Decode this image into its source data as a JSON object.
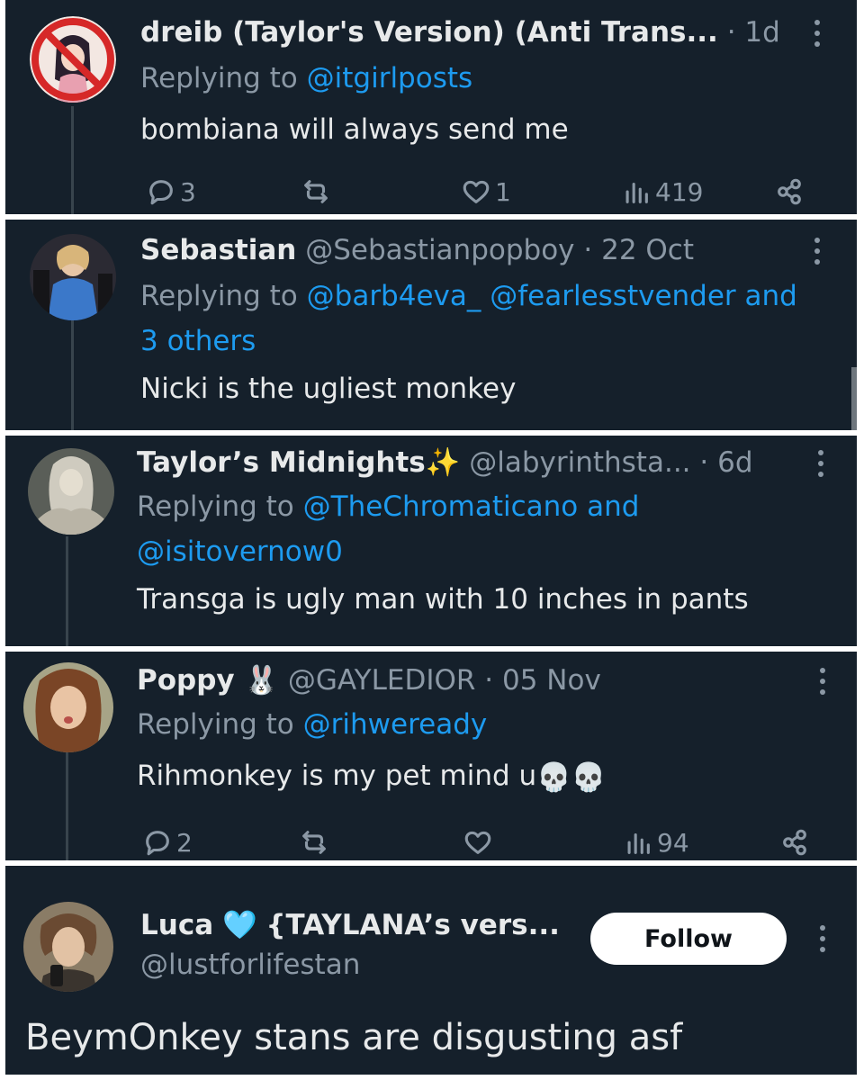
{
  "tweets": [
    {
      "name": "dreib (Taylor's Version) (Anti Trans...",
      "time": "· 1d",
      "replying_prefix": "Replying to",
      "replying_to": "@itgirlposts",
      "text": "bombiana will always send me",
      "actions": {
        "replies": "3",
        "likes": "1",
        "views": "419"
      }
    },
    {
      "name": "Sebastian",
      "handle": "@Sebastianpopboy",
      "time": "· 22 Oct",
      "replying_prefix": "Replying to",
      "replying_to_line1": "@barb4eva_ @fearlesstvender and",
      "replying_to_line2": "3 others",
      "text": "Nicki is the ugliest monkey"
    },
    {
      "name": "Taylor’s Midnights✨",
      "handle": "@labyrinthsta...",
      "time": "· 6d",
      "replying_prefix": "Replying to",
      "replying_to_line1": "@TheChromaticano and",
      "replying_to_line2": "@isitovernow0",
      "text": "Transga is ugly man with 10 inches in pants"
    },
    {
      "name": "Poppy 🐰",
      "handle": "@GAYLEDIOR",
      "time": "· 05 Nov",
      "replying_prefix": "Replying to",
      "replying_to": "@rihweready",
      "text": "Rihmonkey is my pet mind u",
      "text_emoji": "💀💀",
      "actions": {
        "replies": "2",
        "views": "94"
      }
    },
    {
      "name": "Luca",
      "name_emoji": "🩵",
      "name_suffix": "{TAYLANA’s vers...",
      "handle": "@lustforlifestan",
      "follow_label": "Follow",
      "text": "BeymOnkey stans are disgusting asf"
    }
  ],
  "colors": {
    "background": "#15202b",
    "accent": "#1d9bf0",
    "muted": "#8b98a5",
    "text": "#e7e9ea"
  },
  "icons": [
    "reply-icon",
    "retweet-icon",
    "like-icon",
    "views-icon",
    "share-icon",
    "more-icon"
  ]
}
